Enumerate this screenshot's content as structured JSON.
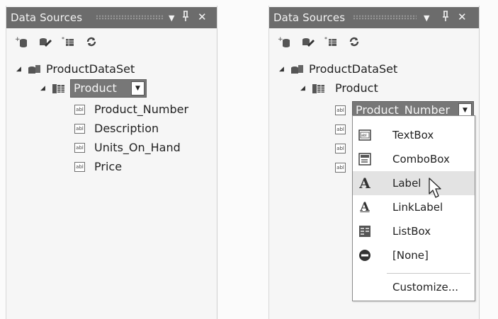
{
  "panels": {
    "left": {
      "title": "Data Sources",
      "title_buttons": {
        "dropdown": "▼",
        "pin": "ꟷ",
        "close": "✕"
      },
      "toolbar_icons": [
        "add-data-source-icon",
        "edit-dataset-icon",
        "configure-dataset-icon",
        "refresh-icon"
      ],
      "dataset": "ProductDataSet",
      "table": "Product",
      "fields": [
        "Product_Number",
        "Description",
        "Units_On_Hand",
        "Price"
      ]
    },
    "right": {
      "title": "Data Sources",
      "title_buttons": {
        "dropdown": "▼",
        "pin": "ꟷ",
        "close": "✕"
      },
      "toolbar_icons": [
        "add-data-source-icon",
        "edit-dataset-icon",
        "configure-dataset-icon",
        "refresh-icon"
      ],
      "dataset": "ProductDataSet",
      "table": "Product",
      "selected_field": "Product_Number",
      "menu": {
        "items": [
          {
            "label": "TextBox",
            "icon": "textbox-icon"
          },
          {
            "label": "ComboBox",
            "icon": "combobox-icon"
          },
          {
            "label": "Label",
            "icon": "label-icon"
          },
          {
            "label": "LinkLabel",
            "icon": "linklabel-icon"
          },
          {
            "label": "ListBox",
            "icon": "listbox-icon"
          },
          {
            "label": "[None]",
            "icon": "none-icon"
          }
        ],
        "customize_label": "Customize...",
        "hovered_item": "Label"
      }
    }
  },
  "icon_glyphs": {
    "abl": "abl"
  }
}
